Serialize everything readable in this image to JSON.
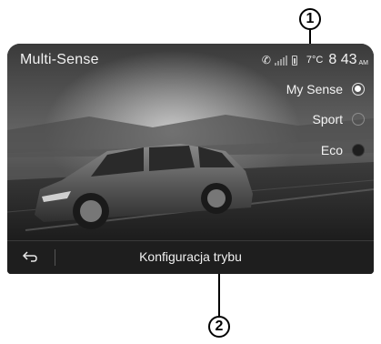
{
  "screen": {
    "title": "Multi-Sense",
    "status": {
      "phone_icon": "phone-handset-icon",
      "signal_icon": "signal-bars-icon",
      "battery_icon": "battery-icon",
      "temperature": "7°C",
      "time": "8 43",
      "ampm": "AM"
    },
    "modes": [
      {
        "label": "My Sense",
        "selected": true
      },
      {
        "label": "Sport",
        "selected": false
      },
      {
        "label": "Eco",
        "selected": false
      }
    ],
    "bottom_bar": {
      "back_icon": "back-arrow-icon",
      "label": "Konfiguracja trybu"
    }
  },
  "callouts": {
    "one": "1",
    "two": "2"
  },
  "colors": {
    "text": "#f2f2f2",
    "bar": "#1e1e1e",
    "callout_border": "#000000"
  }
}
